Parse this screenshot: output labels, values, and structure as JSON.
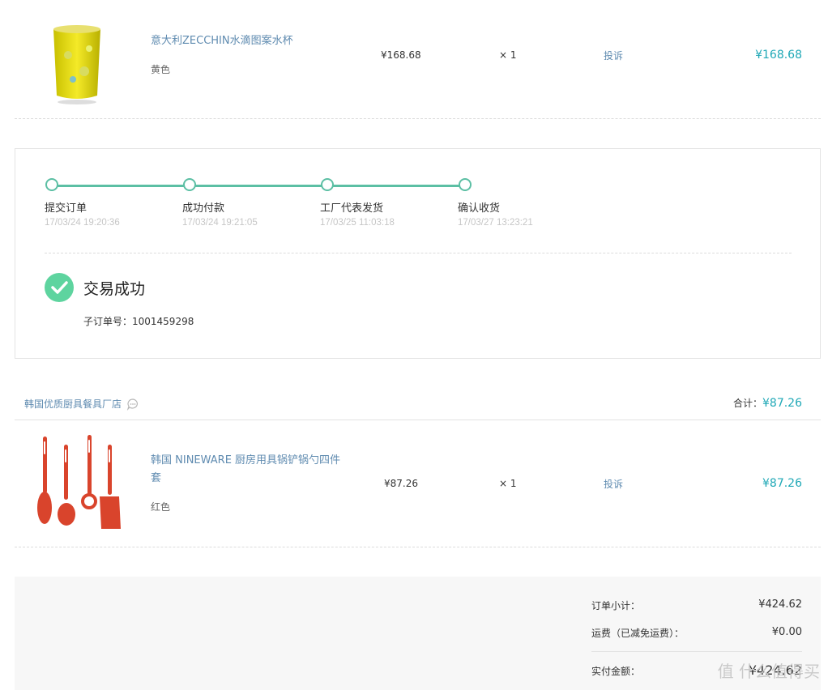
{
  "product1": {
    "name": "意大利ZECCHIN水滴图案水杯",
    "variant": "黄色",
    "price": "¥168.68",
    "qty": "× 1",
    "complain": "投诉",
    "total": "¥168.68"
  },
  "status": {
    "steps": [
      {
        "label": "提交订单",
        "time": "17/03/24 19:20:36"
      },
      {
        "label": "成功付款",
        "time": "17/03/24 19:21:05"
      },
      {
        "label": "工厂代表发货",
        "time": "17/03/25 11:03:18"
      },
      {
        "label": "确认收货",
        "time": "17/03/27 13:23:21"
      }
    ],
    "result": "交易成功",
    "suborder": "子订单号：1001459298"
  },
  "shop": {
    "name": "韩国优质厨具餐具厂店",
    "sum_label": "合计：",
    "sum_value": "¥87.26"
  },
  "product2": {
    "name": "韩国 NINEWARE 厨房用具锅铲锅勺四件套",
    "variant": "红色",
    "price": "¥87.26",
    "qty": "× 1",
    "complain": "投诉",
    "total": "¥87.26"
  },
  "summary": {
    "subtotal_label": "订单小计：",
    "subtotal_value": "¥424.62",
    "shipping_label": "运费（已减免运费）：",
    "shipping_value": "¥0.00",
    "paid_label": "实付金额：",
    "paid_value": "¥424.62"
  },
  "watermark": "值 什么值得买",
  "colors": {
    "accent": "#5cbfa4",
    "price": "#1fa8b6",
    "link": "#5f8bb0",
    "success": "#5ed49f"
  }
}
